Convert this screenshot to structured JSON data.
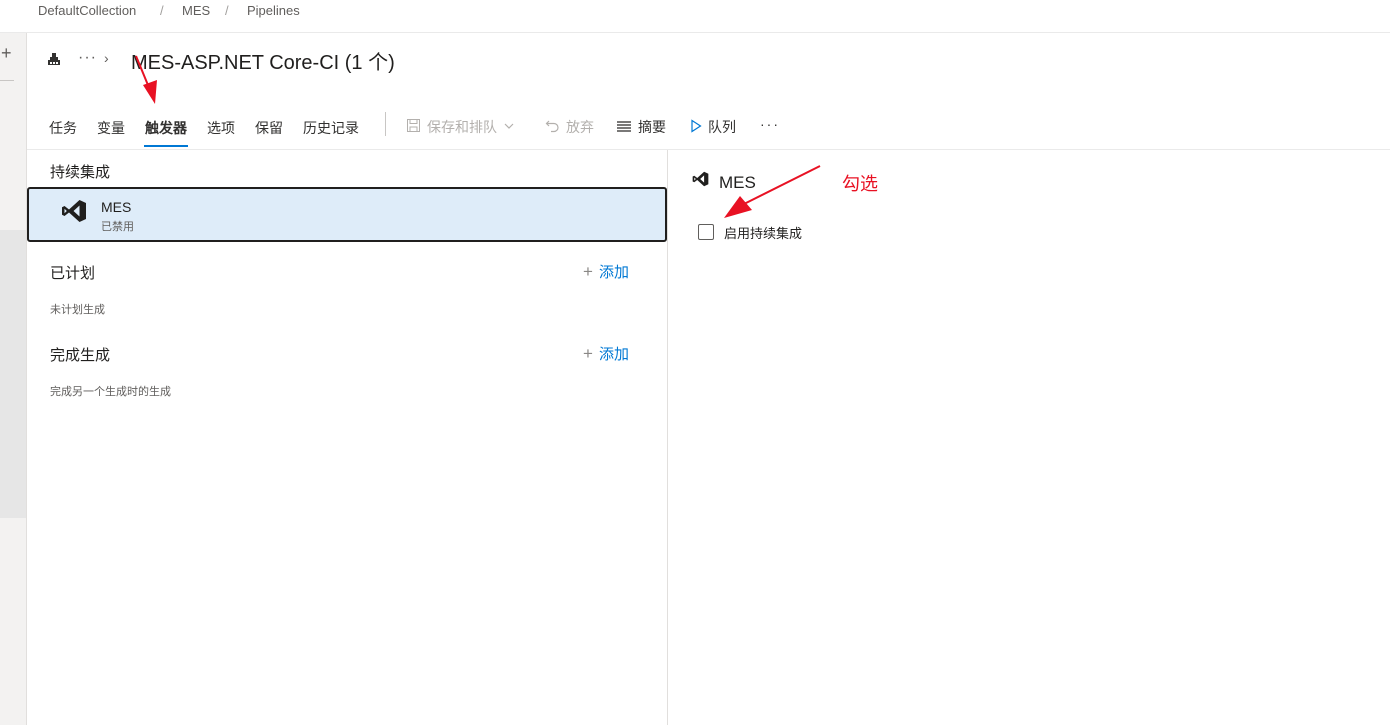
{
  "breadcrumb": [
    "DefaultCollection",
    "MES",
    "Pipelines"
  ],
  "breadcrumb_separator": "/",
  "rail": {
    "plus": "+"
  },
  "header": {
    "overflow": "···",
    "chevron": "›",
    "title": "MES-ASP.NET Core-CI (1 个)",
    "icon": "build-pipeline-icon"
  },
  "tabs": [
    {
      "label": "任务",
      "active": false
    },
    {
      "label": "变量",
      "active": false
    },
    {
      "label": "触发器",
      "active": true
    },
    {
      "label": "选项",
      "active": false
    },
    {
      "label": "保留",
      "active": false
    },
    {
      "label": "历史记录",
      "active": false
    }
  ],
  "toolbar": {
    "save_queue": "保存和排队",
    "discard": "放弃",
    "summary": "摘要",
    "queue": "队列",
    "more": "···"
  },
  "left": {
    "ci": {
      "heading": "持续集成",
      "item": {
        "name": "MES",
        "status": "已禁用",
        "icon": "visual-studio-icon"
      }
    },
    "scheduled": {
      "heading": "已计划",
      "add": "添加",
      "desc": "未计划生成"
    },
    "completion": {
      "heading": "完成生成",
      "add": "添加",
      "desc": "完成另一个生成时的生成"
    }
  },
  "right": {
    "repo": "MES",
    "checkbox_label": "启用持续集成",
    "checked": false
  },
  "annotation": {
    "text": "勾选",
    "color": "#e81123"
  },
  "colors": {
    "accent": "#0078d4",
    "selected_bg": "#deecf9"
  }
}
